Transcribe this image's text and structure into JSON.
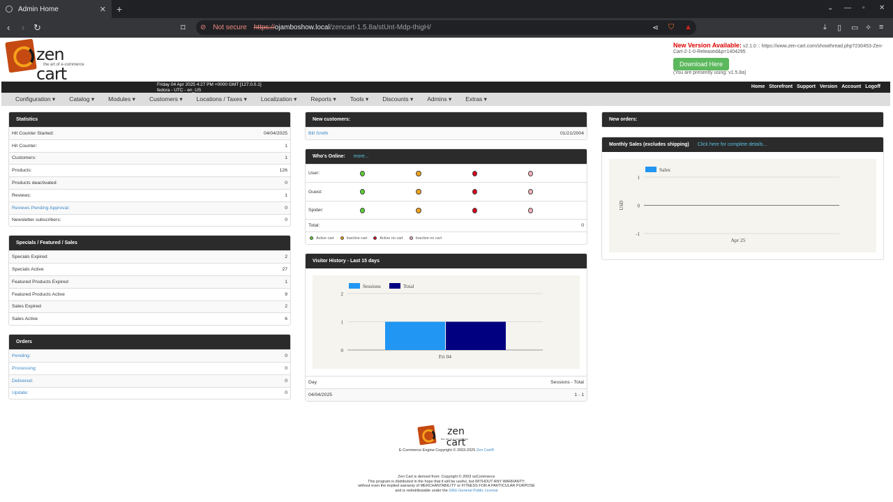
{
  "browser": {
    "tab_title": "Admin Home",
    "security_label": "Not secure",
    "url_scheme": "https://",
    "url_host": "ojamboshow.local",
    "url_path": "/zencart-1.5.8a/stUnt-Mdp-thigH/"
  },
  "header": {
    "logo_name": "zen cart",
    "logo_tagline": "the art of e-commerce",
    "new_version_title": "New Version Available:",
    "new_version_text": "v2.1.0 :: https://www.zen-cart.com/showthread.php?230453-Zen-Cart-2-1-0-Released&p=1404295",
    "download_label": "Download Here",
    "current_version": "(You are presently using: v1.5.8a)",
    "datetime": "Friday 04 Apr 2025 4:27 PM +0000 GMT [127.0.0.1]",
    "host_info": "fedora - UTC - en_US",
    "links": [
      "Home",
      "Storefront",
      "Support",
      "Version",
      "Account",
      "Logoff"
    ]
  },
  "menu": [
    "Configuration",
    "Catalog",
    "Modules",
    "Customers",
    "Locations / Taxes",
    "Localization",
    "Reports",
    "Tools",
    "Discounts",
    "Admins",
    "Extras"
  ],
  "statistics": {
    "title": "Statistics",
    "rows": [
      {
        "label": "Hit Counter Started:",
        "value": "04/04/2025"
      },
      {
        "label": "Hit Counter:",
        "value": "1"
      },
      {
        "label": "Customers:",
        "value": "1"
      },
      {
        "label": "Products:",
        "value": "126"
      },
      {
        "label": "Products deactivated:",
        "value": "0"
      },
      {
        "label": "Reviews:",
        "value": "1"
      },
      {
        "label": "Reviews Pending Approval:",
        "value": "0"
      },
      {
        "label": "Newsletter subscribers:",
        "value": "0"
      }
    ]
  },
  "specials": {
    "title": "Specials / Featured / Sales",
    "rows": [
      {
        "label": "Specials Expired",
        "value": "2"
      },
      {
        "label": "Specials Active",
        "value": "27"
      },
      {
        "label": "Featured Products Expired",
        "value": "1"
      },
      {
        "label": "Featured Products Active",
        "value": "9"
      },
      {
        "label": "Sales Expired",
        "value": "2"
      },
      {
        "label": "Sales Active",
        "value": "6"
      }
    ]
  },
  "orders": {
    "title": "Orders",
    "rows": [
      {
        "label": "Pending:",
        "value": "0"
      },
      {
        "label": "Processing:",
        "value": "0"
      },
      {
        "label": "Delivered:",
        "value": "0"
      },
      {
        "label": "Update:",
        "value": "0"
      }
    ]
  },
  "new_customers": {
    "title": "New customers:",
    "name": "Bill Smith",
    "date": "01/21/2004"
  },
  "whos_online": {
    "title": "Who's Online:",
    "more": "more...",
    "rows": [
      "User:",
      "Guest:",
      "Spider:"
    ],
    "total_label": "Total:",
    "total_value": "0",
    "legend": [
      "Active cart",
      "Inactive cart",
      "Active no cart",
      "Inactive no cart"
    ]
  },
  "visitor_history": {
    "title": "Visitor History - Last 15 days",
    "col_day": "Day",
    "col_sessions": "Sessions - Total",
    "row_day": "04/04/2025",
    "row_value": "1 - 1"
  },
  "new_orders": {
    "title": "New orders:"
  },
  "monthly_sales": {
    "title": "Monthly Sales (excludes shipping)",
    "link": "Click here for complete details..."
  },
  "chart_data": [
    {
      "type": "bar",
      "categories": [
        "Fri 04"
      ],
      "series": [
        {
          "name": "Sessions",
          "values": [
            1
          ],
          "color": "#2196f3"
        },
        {
          "name": "Total",
          "values": [
            1
          ],
          "color": "#000080"
        }
      ],
      "ylim": [
        0,
        2
      ],
      "yticks": [
        "0",
        "1",
        "2"
      ],
      "legend": "top-left"
    },
    {
      "type": "line",
      "categories": [
        "Apr 25"
      ],
      "series": [
        {
          "name": "Sales",
          "values": [
            0
          ],
          "color": "#2196f3"
        }
      ],
      "ylabel": "USD",
      "ylim": [
        -1,
        1
      ],
      "yticks": [
        "-1",
        "0",
        "1"
      ],
      "legend": "top-left"
    }
  ],
  "footer": {
    "copyright": "E-Commerce Engine Copyright © 2003-2025",
    "zen_link": "Zen Cart®",
    "derived": "Zen Cart is derived from: Copyright © 2003 osCommerce",
    "warranty1": "This program is distributed in the hope that it will be useful, but WITHOUT ANY WARRANTY;",
    "warranty2": "without even the implied warranty of MERCHANTABILITY or FITNESS FOR A PARTICULAR PURPOSE",
    "license_pre": "and is redistributable under the",
    "license_link": "GNU General Public License"
  }
}
